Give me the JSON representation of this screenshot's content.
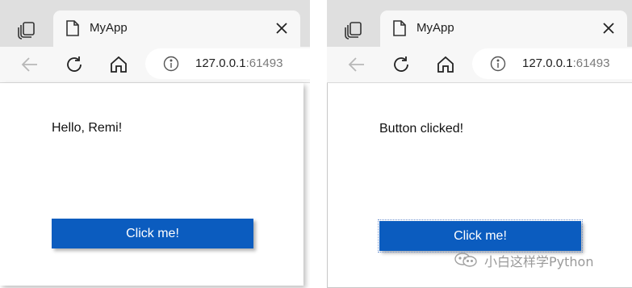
{
  "left_browser": {
    "tab_title": "MyApp",
    "url_host": "127.0.0.1",
    "url_port": ":61493",
    "label_text": "Hello, Remi!",
    "button_label": "Click me!"
  },
  "right_browser": {
    "tab_title": "MyApp",
    "url_host": "127.0.0.1",
    "url_port": ":61493",
    "label_text": "Button clicked!",
    "button_label": "Click me!"
  },
  "watermark": {
    "text": "小白这样学Python"
  },
  "colors": {
    "button_bg": "#0b5cbf",
    "tabbar_bg": "#dfdfdf",
    "toolbar_bg": "#f7f7f7"
  },
  "icons": [
    "tab-actions-icon",
    "page-icon",
    "close-icon",
    "back-arrow-icon",
    "refresh-icon",
    "home-icon",
    "info-icon",
    "wechat-logo-icon"
  ]
}
